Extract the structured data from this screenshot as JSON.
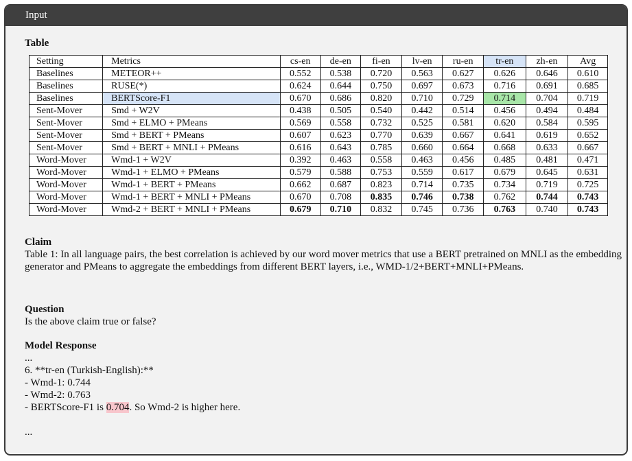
{
  "panel": {
    "title": "Input"
  },
  "table_section": {
    "title": "Table"
  },
  "table": {
    "headers": [
      "Setting",
      "Metrics",
      "cs-en",
      "de-en",
      "fi-en",
      "lv-en",
      "ru-en",
      "tr-en",
      "zh-en",
      "Avg"
    ],
    "rows": [
      [
        "Baselines",
        "METEOR++",
        "0.552",
        "0.538",
        "0.720",
        "0.563",
        "0.627",
        "0.626",
        "0.646",
        "0.610"
      ],
      [
        "Baselines",
        "RUSE(*)",
        "0.624",
        "0.644",
        "0.750",
        "0.697",
        "0.673",
        "0.716",
        "0.691",
        "0.685"
      ],
      [
        "Baselines",
        "BERTScore-F1",
        "0.670",
        "0.686",
        "0.820",
        "0.710",
        "0.729",
        "0.714",
        "0.704",
        "0.719"
      ],
      [
        "Sent-Mover",
        "Smd + W2V",
        "0.438",
        "0.505",
        "0.540",
        "0.442",
        "0.514",
        "0.456",
        "0.494",
        "0.484"
      ],
      [
        "Sent-Mover",
        "Smd + ELMO + PMeans",
        "0.569",
        "0.558",
        "0.732",
        "0.525",
        "0.581",
        "0.620",
        "0.584",
        "0.595"
      ],
      [
        "Sent-Mover",
        "Smd + BERT + PMeans",
        "0.607",
        "0.623",
        "0.770",
        "0.639",
        "0.667",
        "0.641",
        "0.619",
        "0.652"
      ],
      [
        "Sent-Mover",
        "Smd + BERT + MNLI + PMeans",
        "0.616",
        "0.643",
        "0.785",
        "0.660",
        "0.664",
        "0.668",
        "0.633",
        "0.667"
      ],
      [
        "Word-Mover",
        "Wmd-1 + W2V",
        "0.392",
        "0.463",
        "0.558",
        "0.463",
        "0.456",
        "0.485",
        "0.481",
        "0.471"
      ],
      [
        "Word-Mover",
        "Wmd-1 + ELMO + PMeans",
        "0.579",
        "0.588",
        "0.753",
        "0.559",
        "0.617",
        "0.679",
        "0.645",
        "0.631"
      ],
      [
        "Word-Mover",
        "Wmd-1 + BERT + PMeans",
        "0.662",
        "0.687",
        "0.823",
        "0.714",
        "0.735",
        "0.734",
        "0.719",
        "0.725"
      ],
      [
        "Word-Mover",
        "Wmd-1 + BERT + MNLI + PMeans",
        "0.670",
        "0.708",
        "0.835",
        "0.746",
        "0.738",
        "0.762",
        "0.744",
        "0.743"
      ],
      [
        "Word-Mover",
        "Wmd-2 + BERT + MNLI + PMeans",
        "0.679",
        "0.710",
        "0.832",
        "0.745",
        "0.736",
        "0.763",
        "0.740",
        "0.743"
      ]
    ],
    "bold_cells": [
      [
        10,
        4
      ],
      [
        10,
        5
      ],
      [
        10,
        6
      ],
      [
        10,
        8
      ],
      [
        10,
        9
      ],
      [
        11,
        2
      ],
      [
        11,
        3
      ],
      [
        11,
        7
      ],
      [
        11,
        9
      ]
    ],
    "highlight_colors": {
      "blue": "#d6e4f7",
      "green": "#a8e6a8",
      "pink": "#f8c6cc"
    }
  },
  "claim": {
    "title": "Claim",
    "text": "Table 1: In all language pairs, the best correlation is achieved by our word mover metrics that use a BERT pretrained on MNLI as the embedding generator and PMeans to aggregate the embeddings from different BERT layers, i.e., WMD-1/2+BERT+MNLI+PMeans."
  },
  "question": {
    "title": "Question",
    "text": "Is the above claim true or false?"
  },
  "response": {
    "title": "Model Response",
    "line1": "...",
    "line2": "6. **tr-en (Turkish-English):**",
    "line3": "- Wmd-1: 0.744",
    "line4": "- Wmd-2: 0.763",
    "line5_pre": "- BERTScore-F1 is ",
    "line5_hl": "0.704",
    "line5_post": ". So Wmd-2 is higher here.",
    "line6": "..."
  }
}
